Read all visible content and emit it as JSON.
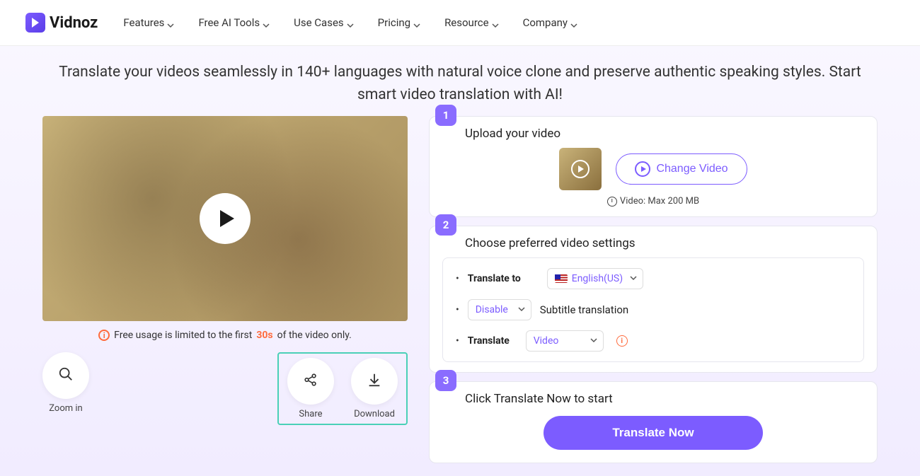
{
  "logo_text": "Vidnoz",
  "nav": [
    {
      "label": "Features"
    },
    {
      "label": "Free AI Tools"
    },
    {
      "label": "Use Cases"
    },
    {
      "label": "Pricing"
    },
    {
      "label": "Resource"
    },
    {
      "label": "Company"
    }
  ],
  "hero_text": "Translate your videos seamlessly in 140+ languages with natural voice clone and preserve authentic speaking styles. Start smart video translation with AI!",
  "notice_pre": "Free usage is limited to the first ",
  "notice_highlight": "30s",
  "notice_post": " of the video only.",
  "actions": {
    "zoom": "Zoom in",
    "share": "Share",
    "download": "Download"
  },
  "steps": {
    "s1": {
      "num": "1",
      "title": "Upload your video",
      "change": "Change Video",
      "limit": "Video: Max 200 MB"
    },
    "s2": {
      "num": "2",
      "title": "Choose preferred video settings",
      "translate_to": "Translate to",
      "lang": "English(US)",
      "subtitle_sel": "Disable",
      "subtitle_label": "Subtitle translation",
      "translate_label": "Translate",
      "translate_sel": "Video"
    },
    "s3": {
      "num": "3",
      "title": "Click Translate Now to start",
      "btn": "Translate Now"
    }
  }
}
